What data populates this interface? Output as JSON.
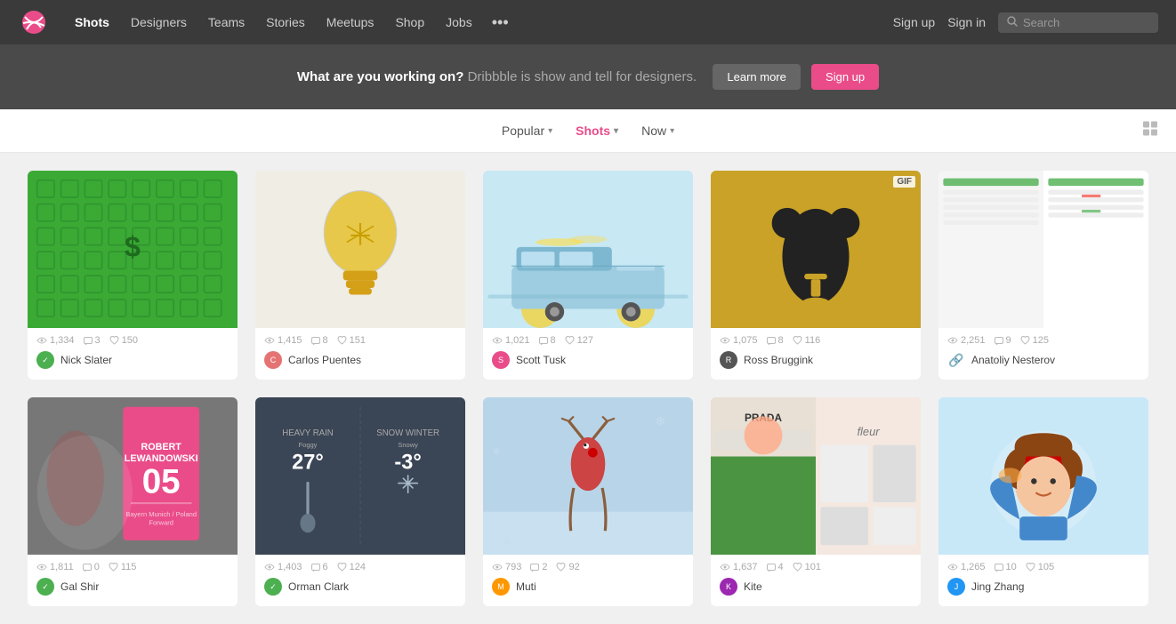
{
  "nav": {
    "logo_label": "Dribbble",
    "links": [
      {
        "label": "Shots",
        "active": true
      },
      {
        "label": "Designers"
      },
      {
        "label": "Teams"
      },
      {
        "label": "Stories"
      },
      {
        "label": "Meetups"
      },
      {
        "label": "Shop"
      },
      {
        "label": "Jobs"
      },
      {
        "label": "•••"
      }
    ],
    "sign_up": "Sign up",
    "sign_in": "Sign in",
    "search_placeholder": "Search"
  },
  "banner": {
    "question": "What are you working on?",
    "description": " Dribbble is show and tell for designers.",
    "learn_more": "Learn more",
    "sign_up": "Sign up"
  },
  "filters": {
    "popular": "Popular",
    "shots": "Shots",
    "now": "Now"
  },
  "shots": [
    {
      "id": 1,
      "thumb_class": "thumb-green",
      "thumb_type": "icons",
      "gif": false,
      "views": "1,334",
      "comments": "3",
      "likes": "150",
      "icon_type": "green",
      "author": "Nick Slater",
      "author_color": "#4caf50"
    },
    {
      "id": 2,
      "thumb_class": "thumb-beige",
      "thumb_type": "lightbulb",
      "gif": false,
      "views": "1,415",
      "comments": "8",
      "likes": "151",
      "icon_type": "avatar",
      "author": "Carlos Puentes",
      "author_color": "#e57373"
    },
    {
      "id": 3,
      "thumb_class": "thumb-lightblue",
      "thumb_type": "van",
      "gif": false,
      "views": "1,021",
      "comments": "8",
      "likes": "127",
      "icon_type": "pink",
      "author": "Scott Tusk",
      "author_color": "#ea4c89"
    },
    {
      "id": 4,
      "thumb_class": "thumb-yellow",
      "thumb_type": "bear",
      "gif": true,
      "views": "1,075",
      "comments": "8",
      "likes": "116",
      "icon_type": "avatar",
      "author": "Ross Bruggink",
      "author_color": "#555"
    },
    {
      "id": 5,
      "thumb_class": "thumb-white-border",
      "thumb_type": "ui",
      "gif": false,
      "views": "2,251",
      "comments": "9",
      "likes": "125",
      "icon_type": "link",
      "author": "Anatoliy Nesterov",
      "author_color": "#e57373"
    },
    {
      "id": 6,
      "thumb_class": "thumb-gray",
      "thumb_type": "football",
      "gif": false,
      "views": "1,811",
      "comments": "0",
      "likes": "115",
      "icon_type": "green",
      "author": "Gal Shir",
      "author_color": "#4caf50"
    },
    {
      "id": 7,
      "thumb_class": "thumb-darkgray",
      "thumb_type": "weather",
      "gif": false,
      "views": "1,403",
      "comments": "6",
      "likes": "124",
      "icon_type": "green",
      "author": "Orman Clark",
      "author_color": "#4caf50"
    },
    {
      "id": 8,
      "thumb_class": "thumb-snow",
      "thumb_type": "reindeer",
      "gif": false,
      "views": "793",
      "comments": "2",
      "likes": "92",
      "icon_type": "avatar",
      "author": "Muti",
      "author_color": "#ff9800"
    },
    {
      "id": 9,
      "thumb_class": "thumb-pink",
      "thumb_type": "fashion",
      "gif": false,
      "views": "1,637",
      "comments": "4",
      "likes": "101",
      "icon_type": "avatar",
      "author": "Kite",
      "author_color": "#9c27b0"
    },
    {
      "id": 10,
      "thumb_class": "thumb-lightblue2",
      "thumb_type": "character",
      "gif": false,
      "views": "1,265",
      "comments": "10",
      "likes": "105",
      "icon_type": "avatar",
      "author": "Jing Zhang",
      "author_color": "#2196f3"
    }
  ]
}
